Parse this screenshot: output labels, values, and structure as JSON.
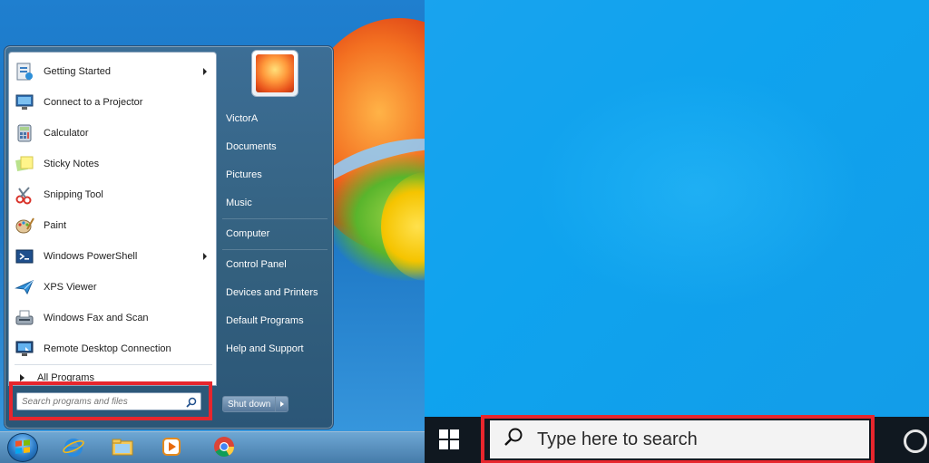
{
  "windows7": {
    "start_menu": {
      "programs": [
        {
          "label": "Getting Started",
          "icon": "getting-started-icon",
          "submenu": true
        },
        {
          "label": "Connect to a Projector",
          "icon": "projector-icon",
          "submenu": false
        },
        {
          "label": "Calculator",
          "icon": "calculator-icon",
          "submenu": false
        },
        {
          "label": "Sticky Notes",
          "icon": "sticky-notes-icon",
          "submenu": false
        },
        {
          "label": "Snipping Tool",
          "icon": "scissors-icon",
          "submenu": false
        },
        {
          "label": "Paint",
          "icon": "paint-palette-icon",
          "submenu": false
        },
        {
          "label": "Windows PowerShell",
          "icon": "powershell-icon",
          "submenu": true
        },
        {
          "label": "XPS Viewer",
          "icon": "xps-viewer-icon",
          "submenu": false
        },
        {
          "label": "Windows Fax and Scan",
          "icon": "fax-icon",
          "submenu": false
        },
        {
          "label": "Remote Desktop Connection",
          "icon": "remote-desktop-icon",
          "submenu": false
        }
      ],
      "all_programs": "All Programs",
      "search_placeholder": "Search programs and files",
      "user_name": "VictorA",
      "right_links": [
        "Documents",
        "Pictures",
        "Music",
        "Computer",
        "Control Panel",
        "Devices and Printers",
        "Default Programs",
        "Help and Support"
      ],
      "shutdown_label": "Shut down"
    },
    "taskbar": {
      "items": [
        "start-orb-icon",
        "internet-explorer-icon",
        "file-explorer-icon",
        "media-player-icon",
        "chrome-icon"
      ]
    }
  },
  "windows10": {
    "search_placeholder": "Type here to search",
    "taskbar": {
      "items": [
        "windows-logo-icon",
        "search-icon",
        "cortana-icon"
      ]
    }
  },
  "colors": {
    "highlight_box": "#e7262d",
    "win10_taskbar": "#101820",
    "win10_desktop": "#0fa3ee"
  }
}
